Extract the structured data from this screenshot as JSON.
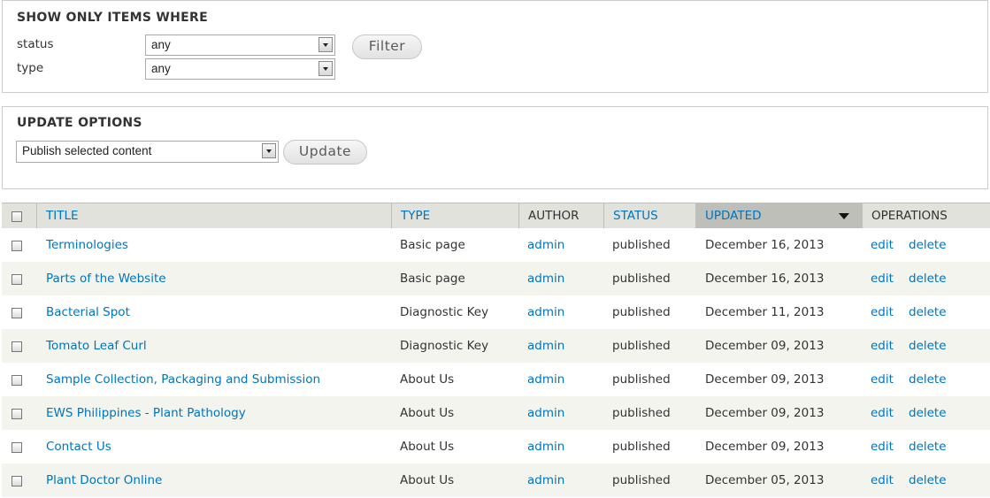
{
  "filter": {
    "title": "SHOW ONLY ITEMS WHERE",
    "status_label": "status",
    "status_value": "any",
    "type_label": "type",
    "type_value": "any",
    "filter_button": "Filter"
  },
  "update": {
    "title": "UPDATE OPTIONS",
    "action_value": "Publish selected content",
    "update_button": "Update"
  },
  "table": {
    "headers": {
      "title": "TITLE",
      "type": "TYPE",
      "author": "AUTHOR",
      "status": "STATUS",
      "updated": "UPDATED",
      "operations": "OPERATIONS"
    },
    "edit_label": "edit",
    "delete_label": "delete",
    "rows": [
      {
        "title": "Terminologies",
        "type": "Basic page",
        "author": "admin",
        "status": "published",
        "updated": "December 16, 2013"
      },
      {
        "title": "Parts of the Website",
        "type": "Basic page",
        "author": "admin",
        "status": "published",
        "updated": "December 16, 2013"
      },
      {
        "title": "Bacterial Spot",
        "type": "Diagnostic Key",
        "author": "admin",
        "status": "published",
        "updated": "December 11, 2013"
      },
      {
        "title": "Tomato Leaf Curl",
        "type": "Diagnostic Key",
        "author": "admin",
        "status": "published",
        "updated": "December 09, 2013"
      },
      {
        "title": "Sample Collection, Packaging and Submission",
        "type": "About Us",
        "author": "admin",
        "status": "published",
        "updated": "December 09, 2013"
      },
      {
        "title": "EWS Philippines - Plant Pathology",
        "type": "About Us",
        "author": "admin",
        "status": "published",
        "updated": "December 09, 2013"
      },
      {
        "title": "Contact Us",
        "type": "About Us",
        "author": "admin",
        "status": "published",
        "updated": "December 09, 2013"
      },
      {
        "title": "Plant Doctor Online",
        "type": "About Us",
        "author": "admin",
        "status": "published",
        "updated": "December 05, 2013"
      }
    ]
  },
  "colors": {
    "link": "#0074bd",
    "header_bg": "#e1e2dc",
    "active_header_bg": "#bebfb9",
    "stripe_bg": "#f3f4ee"
  }
}
